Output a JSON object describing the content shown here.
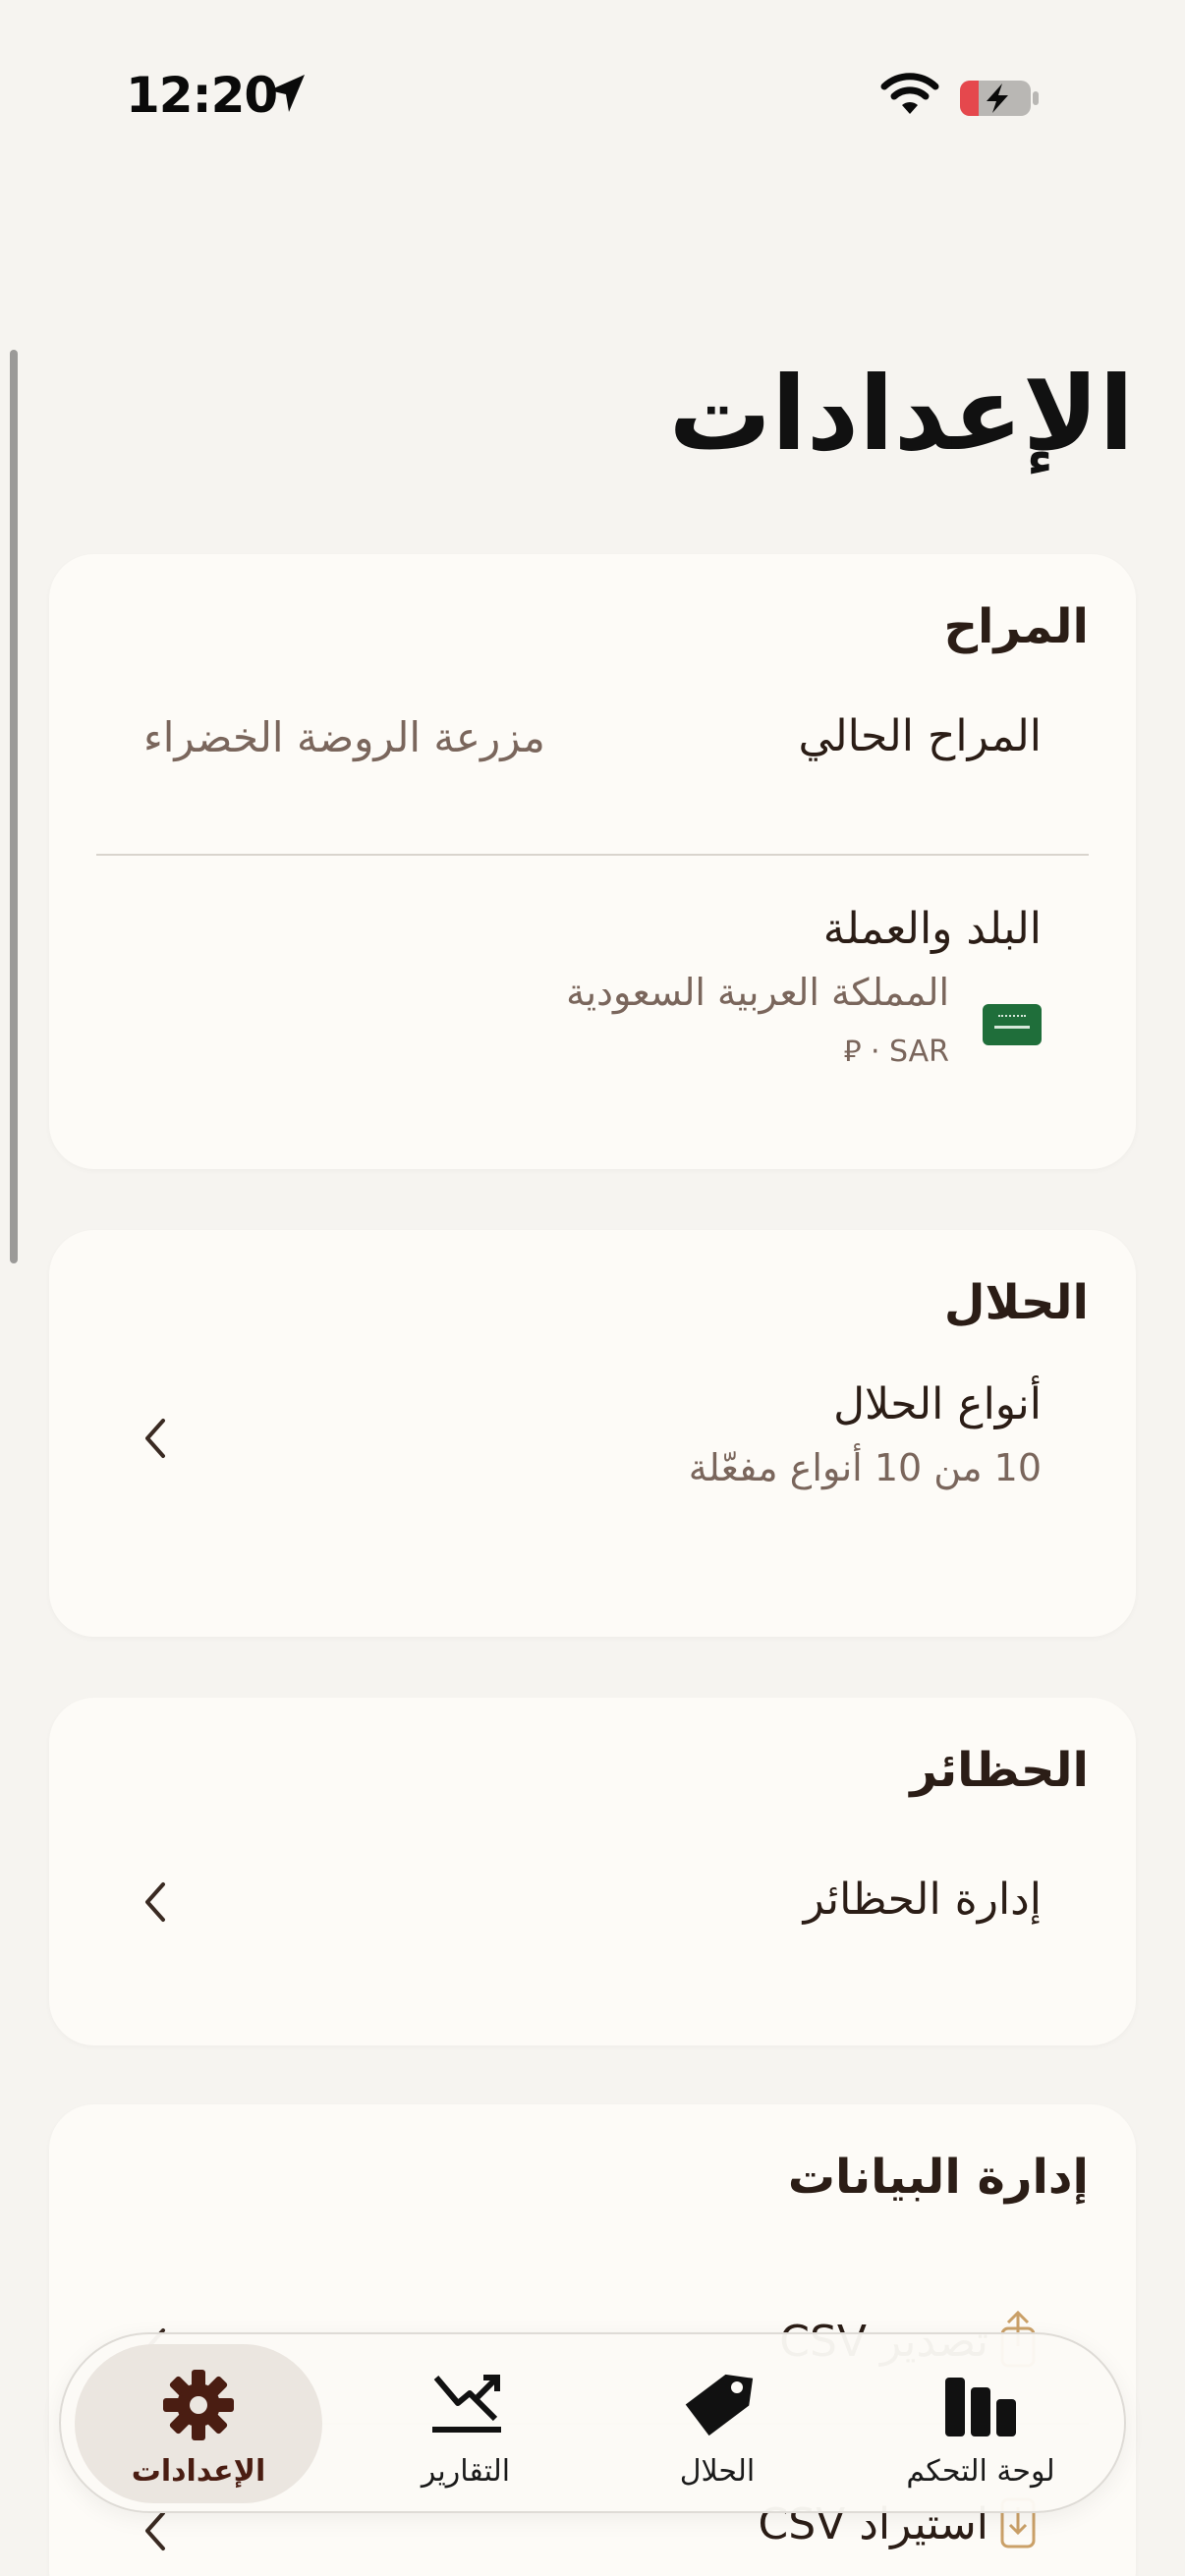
{
  "status_bar": {
    "time": "12:20"
  },
  "page": {
    "title": "الإعدادات"
  },
  "sections": {
    "farm": {
      "title": "المراح",
      "current_label": "المراح الحالي",
      "current_value": "مزرعة الروضة الخضراء",
      "country_label": "البلد والعملة",
      "country_name": "المملكة العربية السعودية",
      "currency": "⃁ · SAR"
    },
    "livestock": {
      "title": "الحلال",
      "types_label": "أنواع الحلال",
      "types_summary": "10 من 10 أنواع مفعّلة"
    },
    "pens": {
      "title": "الحظائر",
      "manage_label": "إدارة الحظائر"
    },
    "data": {
      "title": "إدارة البيانات",
      "export_label": "تصدير CSV",
      "import_label": "استيراد CSV"
    }
  },
  "tab_bar": {
    "tabs": [
      {
        "label": "الإعدادات",
        "icon": "gear-icon",
        "active": true
      },
      {
        "label": "التقارير",
        "icon": "chart-icon",
        "active": false
      },
      {
        "label": "الحلال",
        "icon": "tag-icon",
        "active": false
      },
      {
        "label": "لوحة التحكم",
        "icon": "bar-chart-icon",
        "active": false
      }
    ]
  },
  "colors": {
    "background": "#f6f4f0",
    "card": "#fdfbf7",
    "text_primary": "#2b1d16",
    "text_secondary": "#7a665c",
    "accent": "#4a1d12",
    "battery_low": "#e5484d"
  }
}
